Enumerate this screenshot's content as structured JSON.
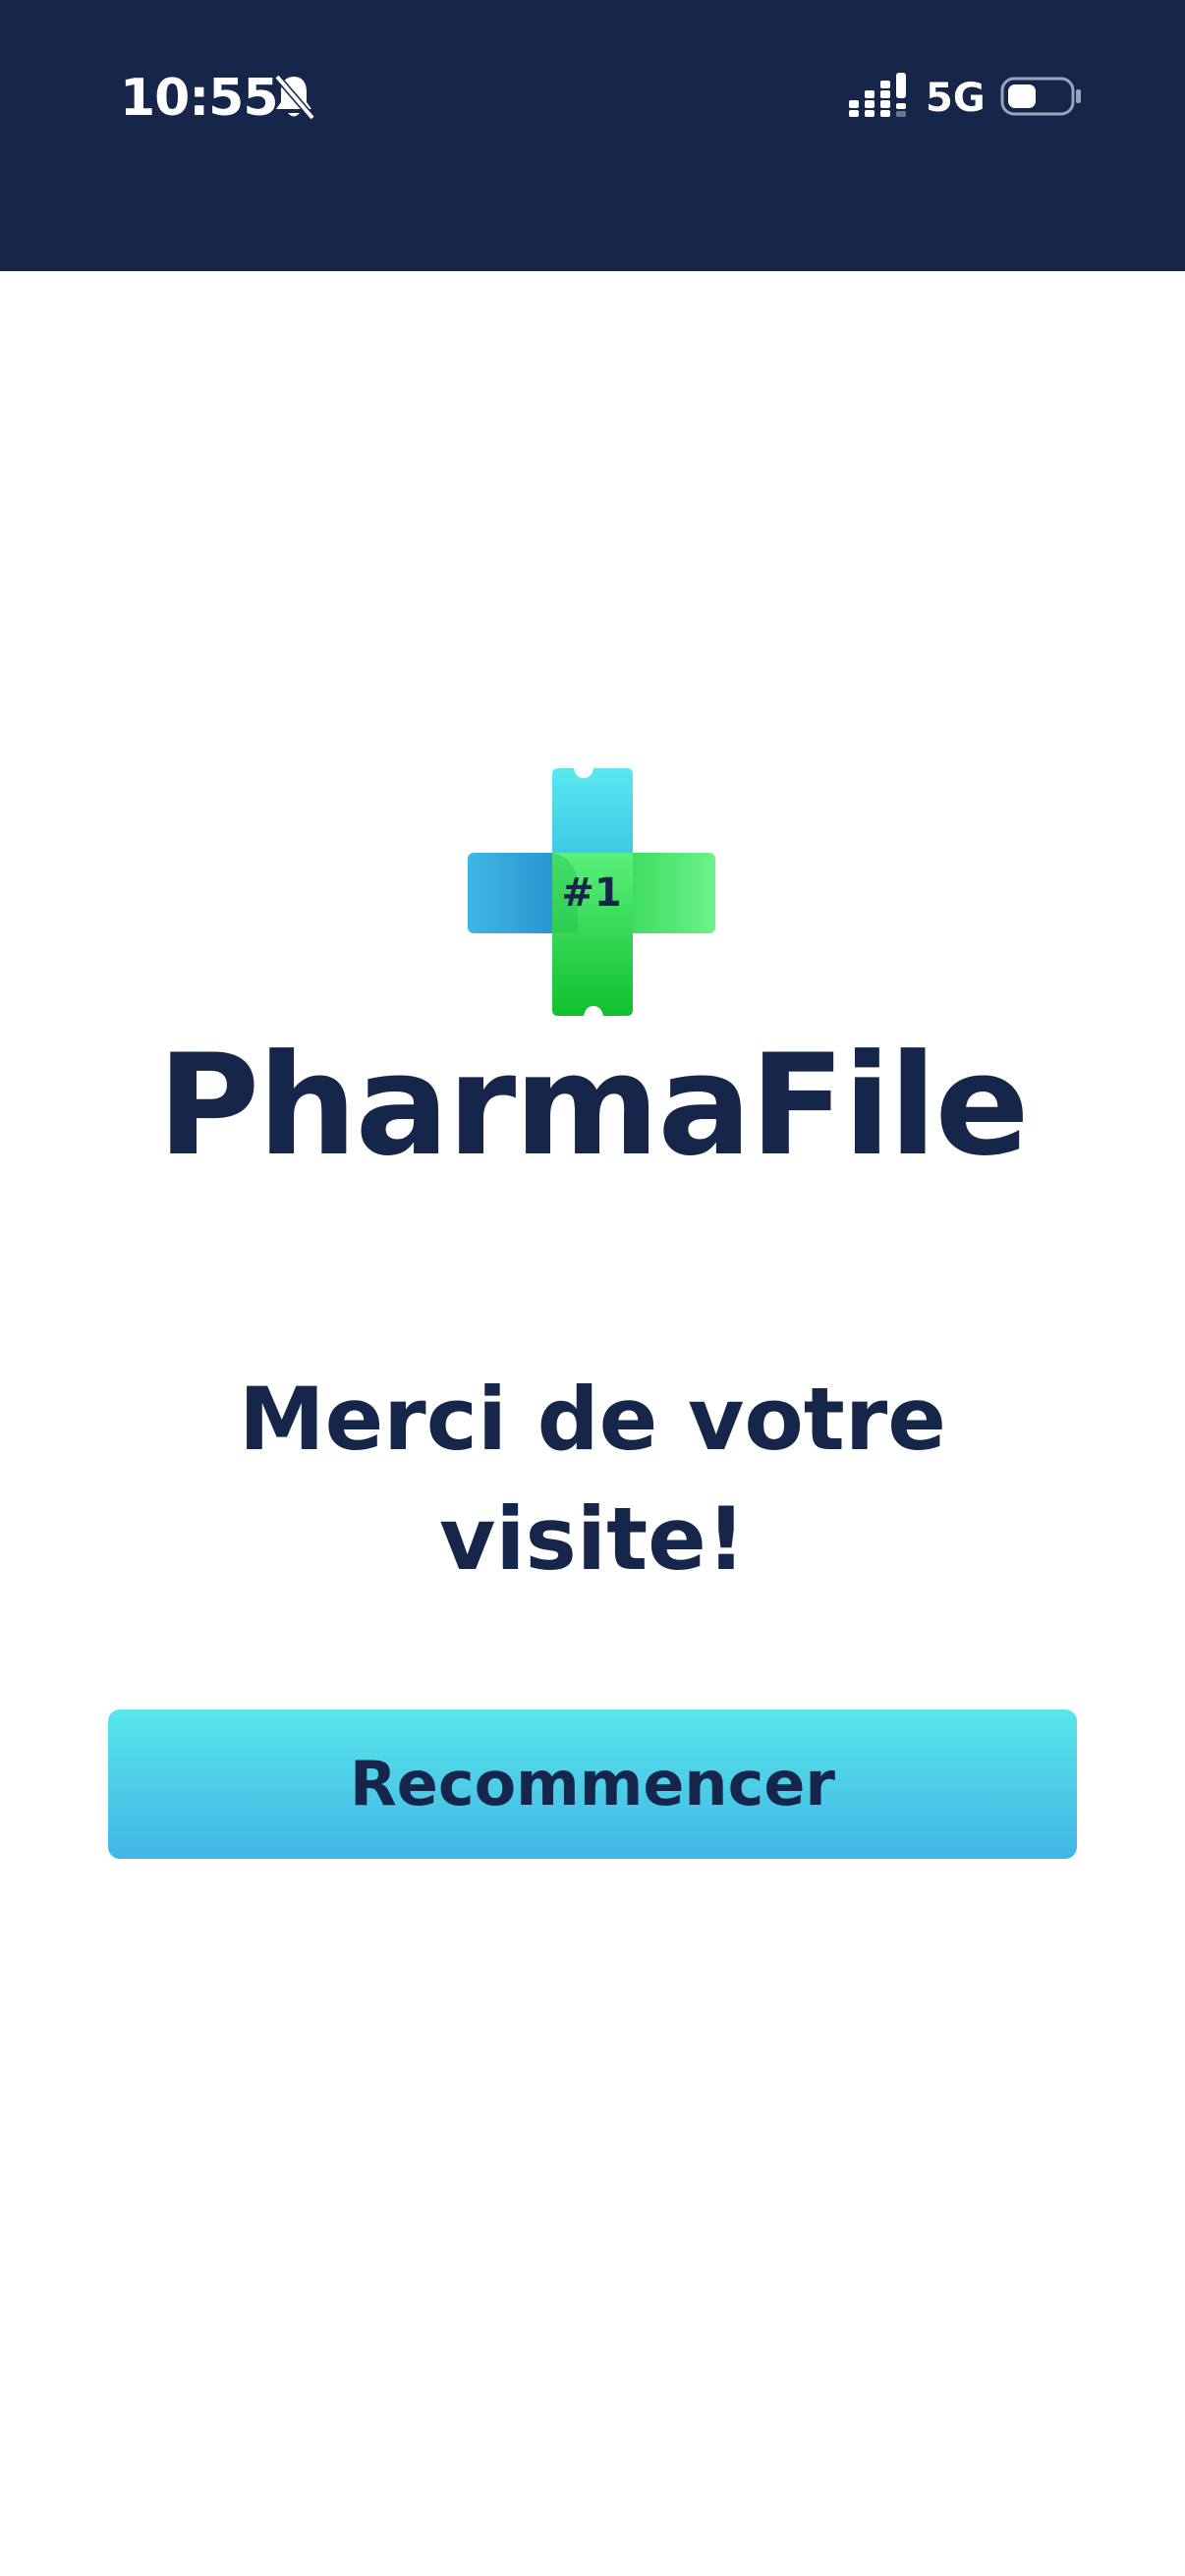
{
  "status_bar": {
    "time": "10:55",
    "network": "5G",
    "icons": [
      "silent-mode-icon",
      "signal-icon",
      "battery-icon"
    ],
    "background": "#16264a"
  },
  "logo": {
    "badge_text": "#1",
    "icon": "pharmacy-cross-ticket-icon",
    "colors": {
      "blue": "#2ea6dc",
      "cyan": "#58e4ee",
      "green": "#2ed84a"
    }
  },
  "brand": {
    "name": "PharmaFile",
    "color": "#16264a"
  },
  "main": {
    "message": "Merci de votre visite!",
    "restart_label": "Recommencer"
  },
  "colors": {
    "button_top": "#58e6ea",
    "button_bottom": "#42b6e6",
    "text": "#16264a"
  }
}
